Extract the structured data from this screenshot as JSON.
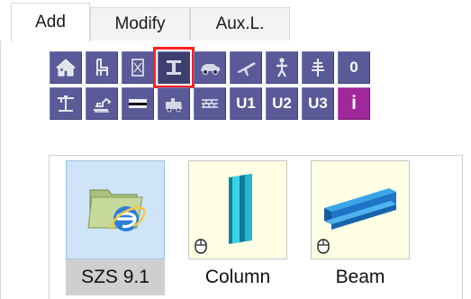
{
  "tabs": [
    {
      "label": "Add",
      "active": true
    },
    {
      "label": "Modify",
      "active": false
    },
    {
      "label": "Aux.L.",
      "active": false
    }
  ],
  "toolbar": {
    "row1": [
      {
        "icon": "house-icon"
      },
      {
        "icon": "chair-icon"
      },
      {
        "icon": "frame-icon"
      },
      {
        "icon": "i-beam-icon",
        "selected": true
      },
      {
        "icon": "car-icon"
      },
      {
        "icon": "airplane-icon"
      },
      {
        "icon": "person-icon"
      },
      {
        "icon": "tree-icon"
      },
      {
        "icon": "letter-o-icon",
        "text": "0"
      }
    ],
    "row2": [
      {
        "icon": "crane-icon"
      },
      {
        "icon": "excavator-icon"
      },
      {
        "icon": "slab-icon"
      },
      {
        "icon": "train-icon"
      },
      {
        "icon": "wall-icon"
      },
      {
        "icon": "u1-icon",
        "text": "U1"
      },
      {
        "icon": "u2-icon",
        "text": "U2"
      },
      {
        "icon": "u3-icon",
        "text": "U3"
      },
      {
        "icon": "info-icon",
        "text": "i"
      }
    ],
    "accent": "#5a5a98",
    "selected_outline": "#ff1f1f"
  },
  "items": [
    {
      "label": "SZS 9.1",
      "icon": "folder-ie-icon",
      "selected": true
    },
    {
      "label": "Column",
      "icon": "column-icon",
      "selected": false
    },
    {
      "label": "Beam",
      "icon": "beam-icon",
      "selected": false
    }
  ]
}
